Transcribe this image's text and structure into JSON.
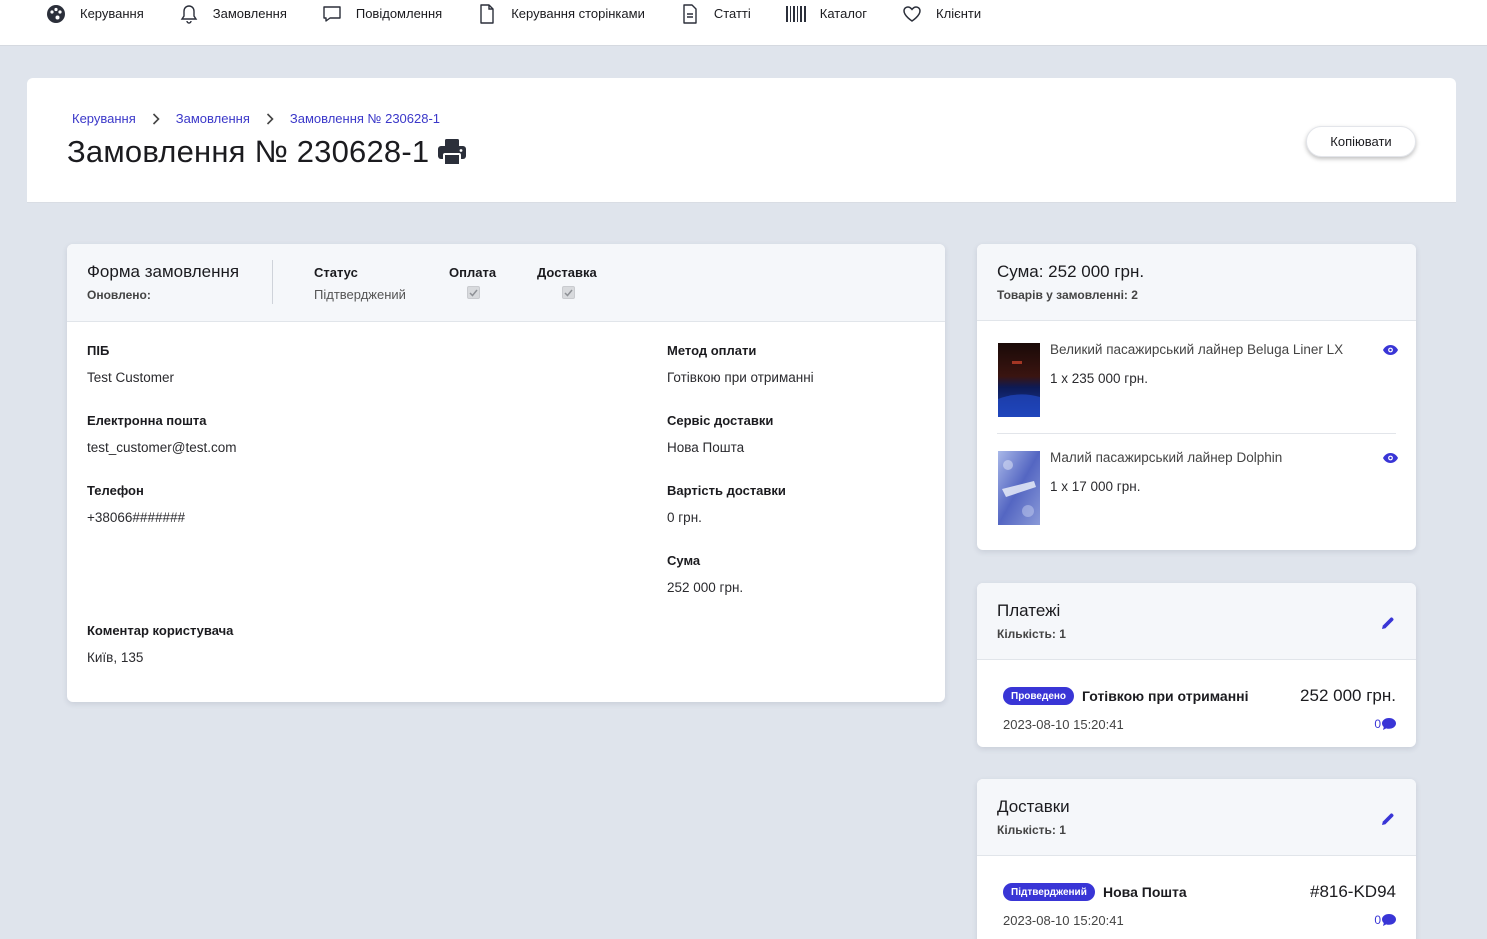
{
  "nav": {
    "items": [
      {
        "label": "Керування",
        "icon": "palette-icon"
      },
      {
        "label": "Замовлення",
        "icon": "bell-icon"
      },
      {
        "label": "Повідомлення",
        "icon": "chat-icon"
      },
      {
        "label": "Керування сторінками",
        "icon": "file-icon"
      },
      {
        "label": "Статті",
        "icon": "document-icon"
      },
      {
        "label": "Каталог",
        "icon": "barcode-icon"
      },
      {
        "label": "Клієнти",
        "icon": "heart-icon"
      }
    ]
  },
  "breadcrumb": [
    "Керування",
    "Замовлення",
    "Замовлення № 230628-1"
  ],
  "page": {
    "title": "Замовлення № 230628-1",
    "copy_label": "Копіювати"
  },
  "order_form": {
    "title": "Форма замовлення",
    "updated_label": "Оновлено:",
    "status_label": "Статус",
    "status_value": "Підтверджений",
    "payment_label": "Оплата",
    "payment_checked": true,
    "delivery_label": "Доставка",
    "delivery_checked": true,
    "name_label": "ПІБ",
    "name_value": "Test Customer",
    "email_label": "Електронна пошта",
    "email_value": "test_customer@test.com",
    "phone_label": "Телефон",
    "phone_value": "+38066#######",
    "comment_label": "Коментар користувача",
    "comment_value": "Київ, 135",
    "pay_method_label": "Метод оплати",
    "pay_method_value": "Готівкою при отриманні",
    "delivery_service_label": "Сервіс доставки",
    "delivery_service_value": "Нова Пошта",
    "delivery_cost_label": "Вартість доставки",
    "delivery_cost_value": "0 грн.",
    "sum_label": "Сума",
    "sum_value": "252 000 грн."
  },
  "summary": {
    "title": "Сума: 252 000 грн.",
    "subtitle": "Товарів у замовленні: 2",
    "products": [
      {
        "name": "Великий пасажирський лайнер Beluga Liner LX",
        "qty": "1 x 235 000 грн."
      },
      {
        "name": "Малий пасажирський лайнер Dolphin",
        "qty": "1 x 17 000 грн."
      }
    ]
  },
  "payments": {
    "title": "Платежі",
    "subtitle": "Кількість: 1",
    "row": {
      "badge": "Проведено",
      "name": "Готівкою при отриманні",
      "amount": "252 000 грн.",
      "date": "2023-08-10 15:20:41",
      "comments": "0"
    }
  },
  "deliveries": {
    "title": "Доставки",
    "subtitle": "Кількість: 1",
    "row": {
      "badge": "Підтверджений",
      "name": "Нова Пошта",
      "amount": "#816-KD94",
      "date": "2023-08-10 15:20:41",
      "comments": "0"
    }
  },
  "colors": {
    "accent": "#3935d6",
    "link": "#3b38c9",
    "background": "#dfe4ec"
  }
}
